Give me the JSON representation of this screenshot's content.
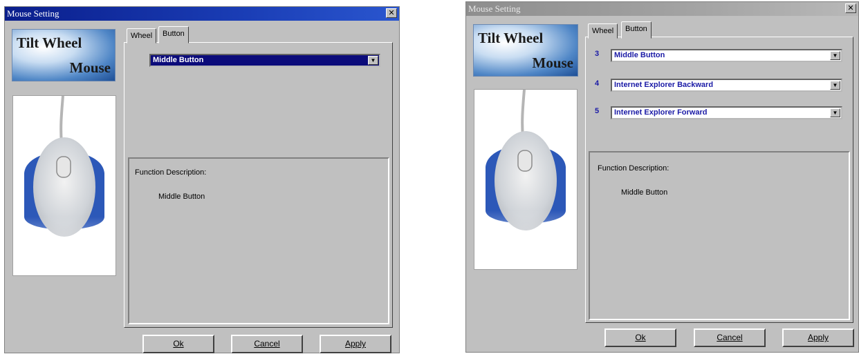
{
  "dialogs": [
    {
      "title": "Mouse Setting",
      "close_glyph": "✕",
      "logo": {
        "line1": "Tilt Wheel",
        "line2": "Mouse"
      },
      "tabs": [
        {
          "label": "Wheel"
        },
        {
          "label": "Button",
          "active": true
        }
      ],
      "selectors": [
        {
          "value": "Middle Button"
        }
      ],
      "function_description": {
        "label": "Function Description:",
        "value": "Middle Button"
      },
      "buttons": {
        "ok": "Ok",
        "cancel": "Cancel",
        "apply": "Apply"
      }
    },
    {
      "title": "Mouse Setting",
      "close_glyph": "✕",
      "logo": {
        "line1": "Tilt Wheel",
        "line2": "Mouse"
      },
      "tabs": [
        {
          "label": "Wheel"
        },
        {
          "label": "Button",
          "active": true
        }
      ],
      "selectors": [
        {
          "number": "3",
          "value": "Middle Button"
        },
        {
          "number": "4",
          "value": "Internet Explorer Backward"
        },
        {
          "number": "5",
          "value": "Internet Explorer Forward"
        }
      ],
      "function_description": {
        "label": "Function Description:",
        "value": "Middle Button"
      },
      "buttons": {
        "ok": "Ok",
        "cancel": "Cancel",
        "apply": "Apply"
      }
    }
  ],
  "icons": {
    "dropdown_arrow": "chevron-down-icon",
    "close": "close-icon"
  },
  "colors": {
    "title_active": "#0a1e8c",
    "title_inactive": "#9a9a9a",
    "selection_highlight": "#0b0b7a",
    "face": "#c0c0c0",
    "combo_text": "#1a1aa6"
  }
}
